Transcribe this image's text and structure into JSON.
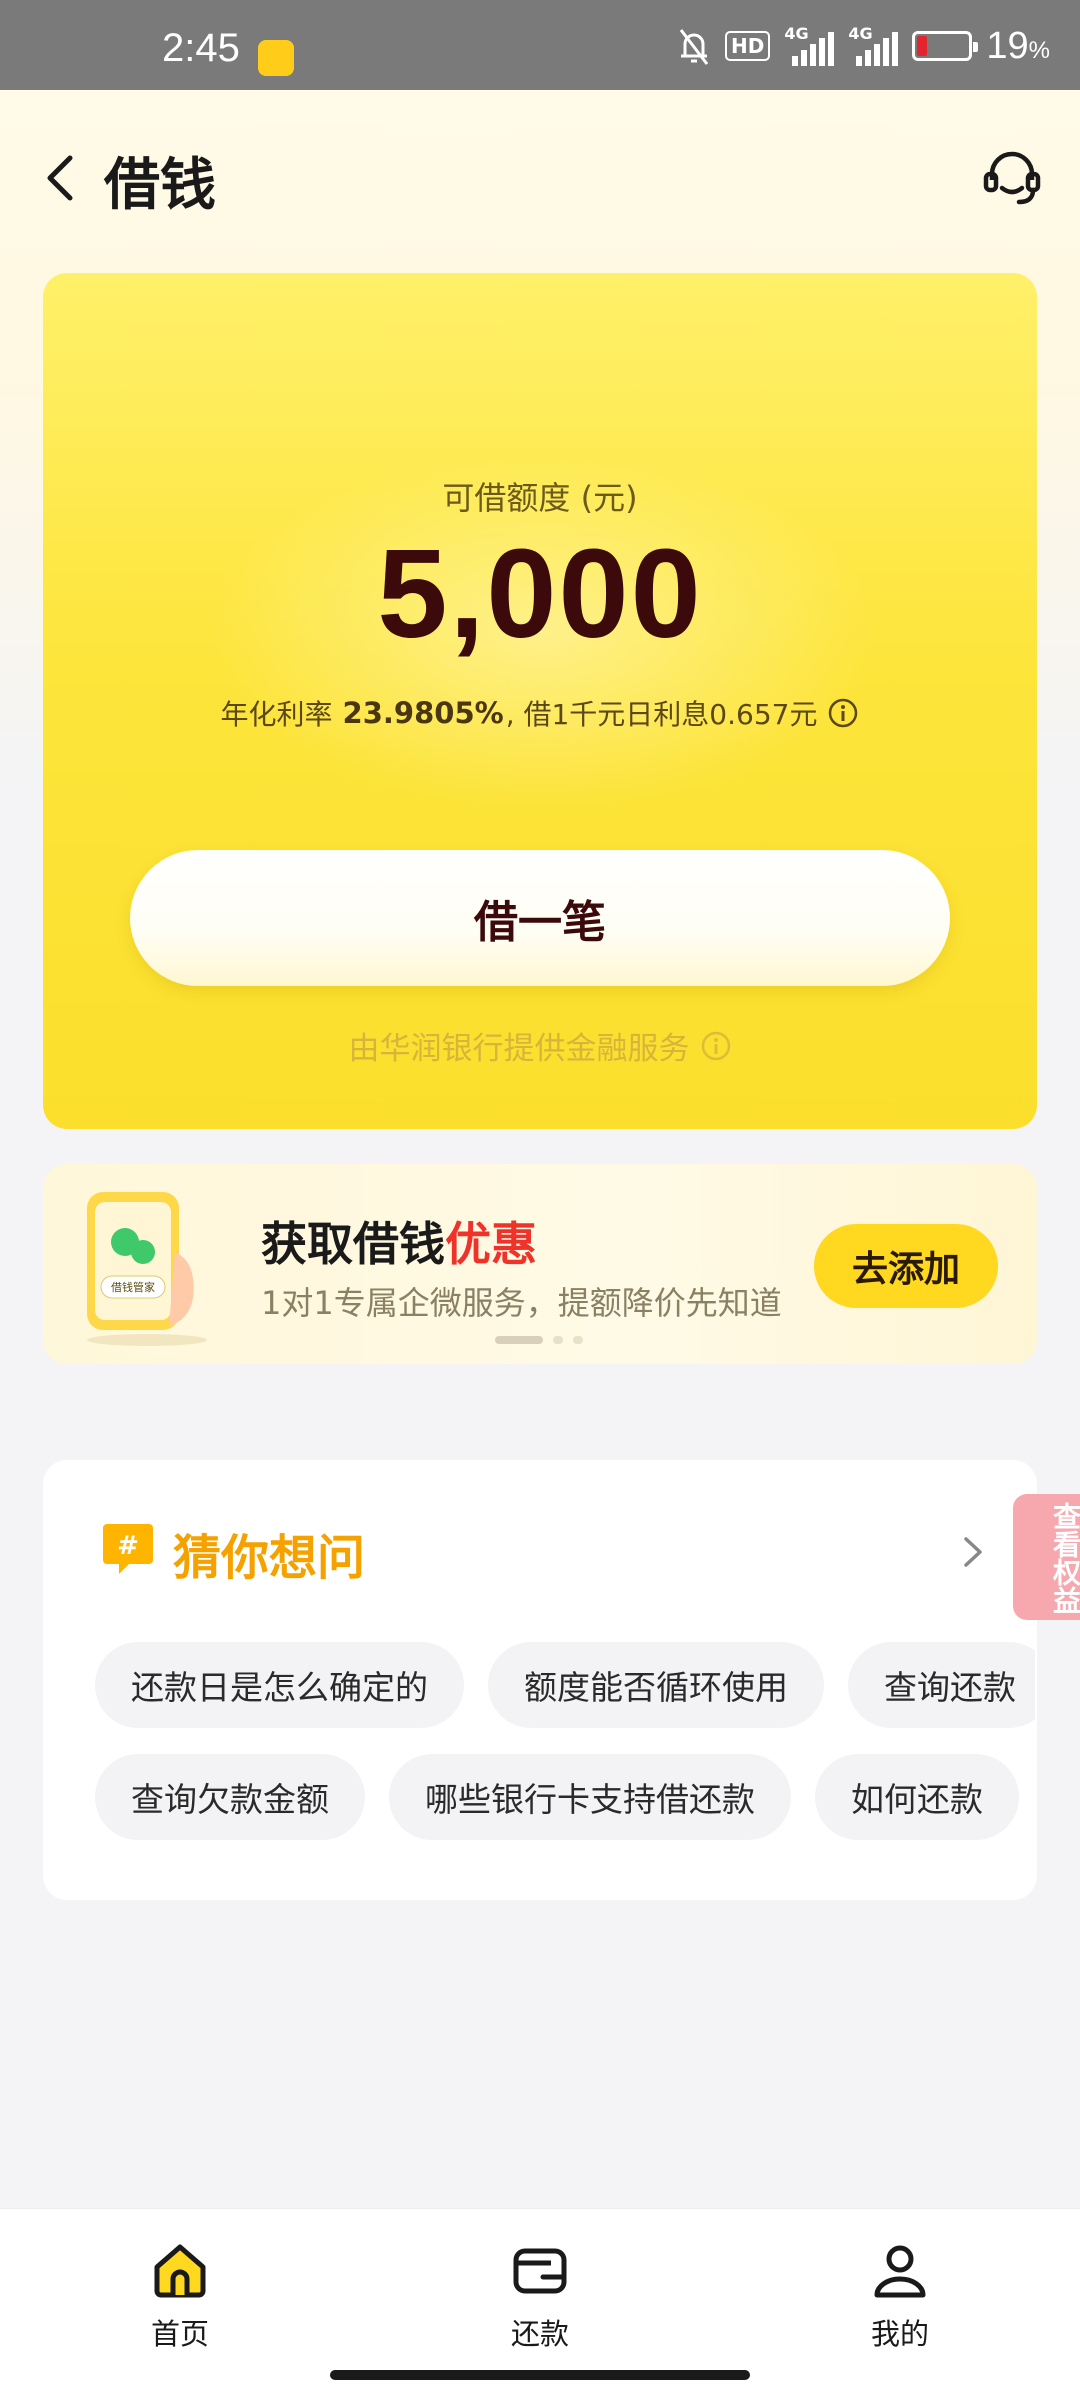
{
  "status_bar": {
    "time": "2:45",
    "hd_label": "HD",
    "signal1_label": "4G",
    "signal2_label": "4G",
    "battery_percent": "19",
    "battery_suffix": "%",
    "battery_level": 0.19,
    "battery_color": "#e3262d"
  },
  "header": {
    "title": "借钱",
    "back_icon": "chevron-left-icon",
    "service_icon": "headset-icon"
  },
  "loan_card": {
    "limit_label": "可借额度 (元)",
    "limit_value": "5,000",
    "rate_prefix": "年化利率",
    "rate_value": "23.9805%",
    "rate_suffix": ", 借1千元日利息0.657元",
    "borrow_button": "借一笔",
    "provider_text": "由华润银行提供金融服务"
  },
  "promo": {
    "title_main": "获取借钱",
    "title_highlight": "优惠",
    "subtitle": "1对1专属企微服务，提额降价先知道",
    "button": "去添加",
    "art_label": "借钱管家",
    "carousel_active_index": 0,
    "carousel_count": 3
  },
  "faq": {
    "title": "猜你想问",
    "row1": [
      "还款日是怎么确定的",
      "额度能否循环使用",
      "查询还款"
    ],
    "row2": [
      "查询欠款金额",
      "哪些银行卡支持借还款",
      "如何还款"
    ]
  },
  "side_tag": "查看权益",
  "tabbar": {
    "items": [
      {
        "label": "首页",
        "icon": "home-icon",
        "active": true
      },
      {
        "label": "还款",
        "icon": "wallet-icon",
        "active": false
      },
      {
        "label": "我的",
        "icon": "user-icon",
        "active": false
      }
    ]
  },
  "colors": {
    "accent_yellow": "#fde53b",
    "faq_title": "#f5a200",
    "highlight_red": "#f0332a",
    "amount_dark": "#3c0a0a"
  }
}
